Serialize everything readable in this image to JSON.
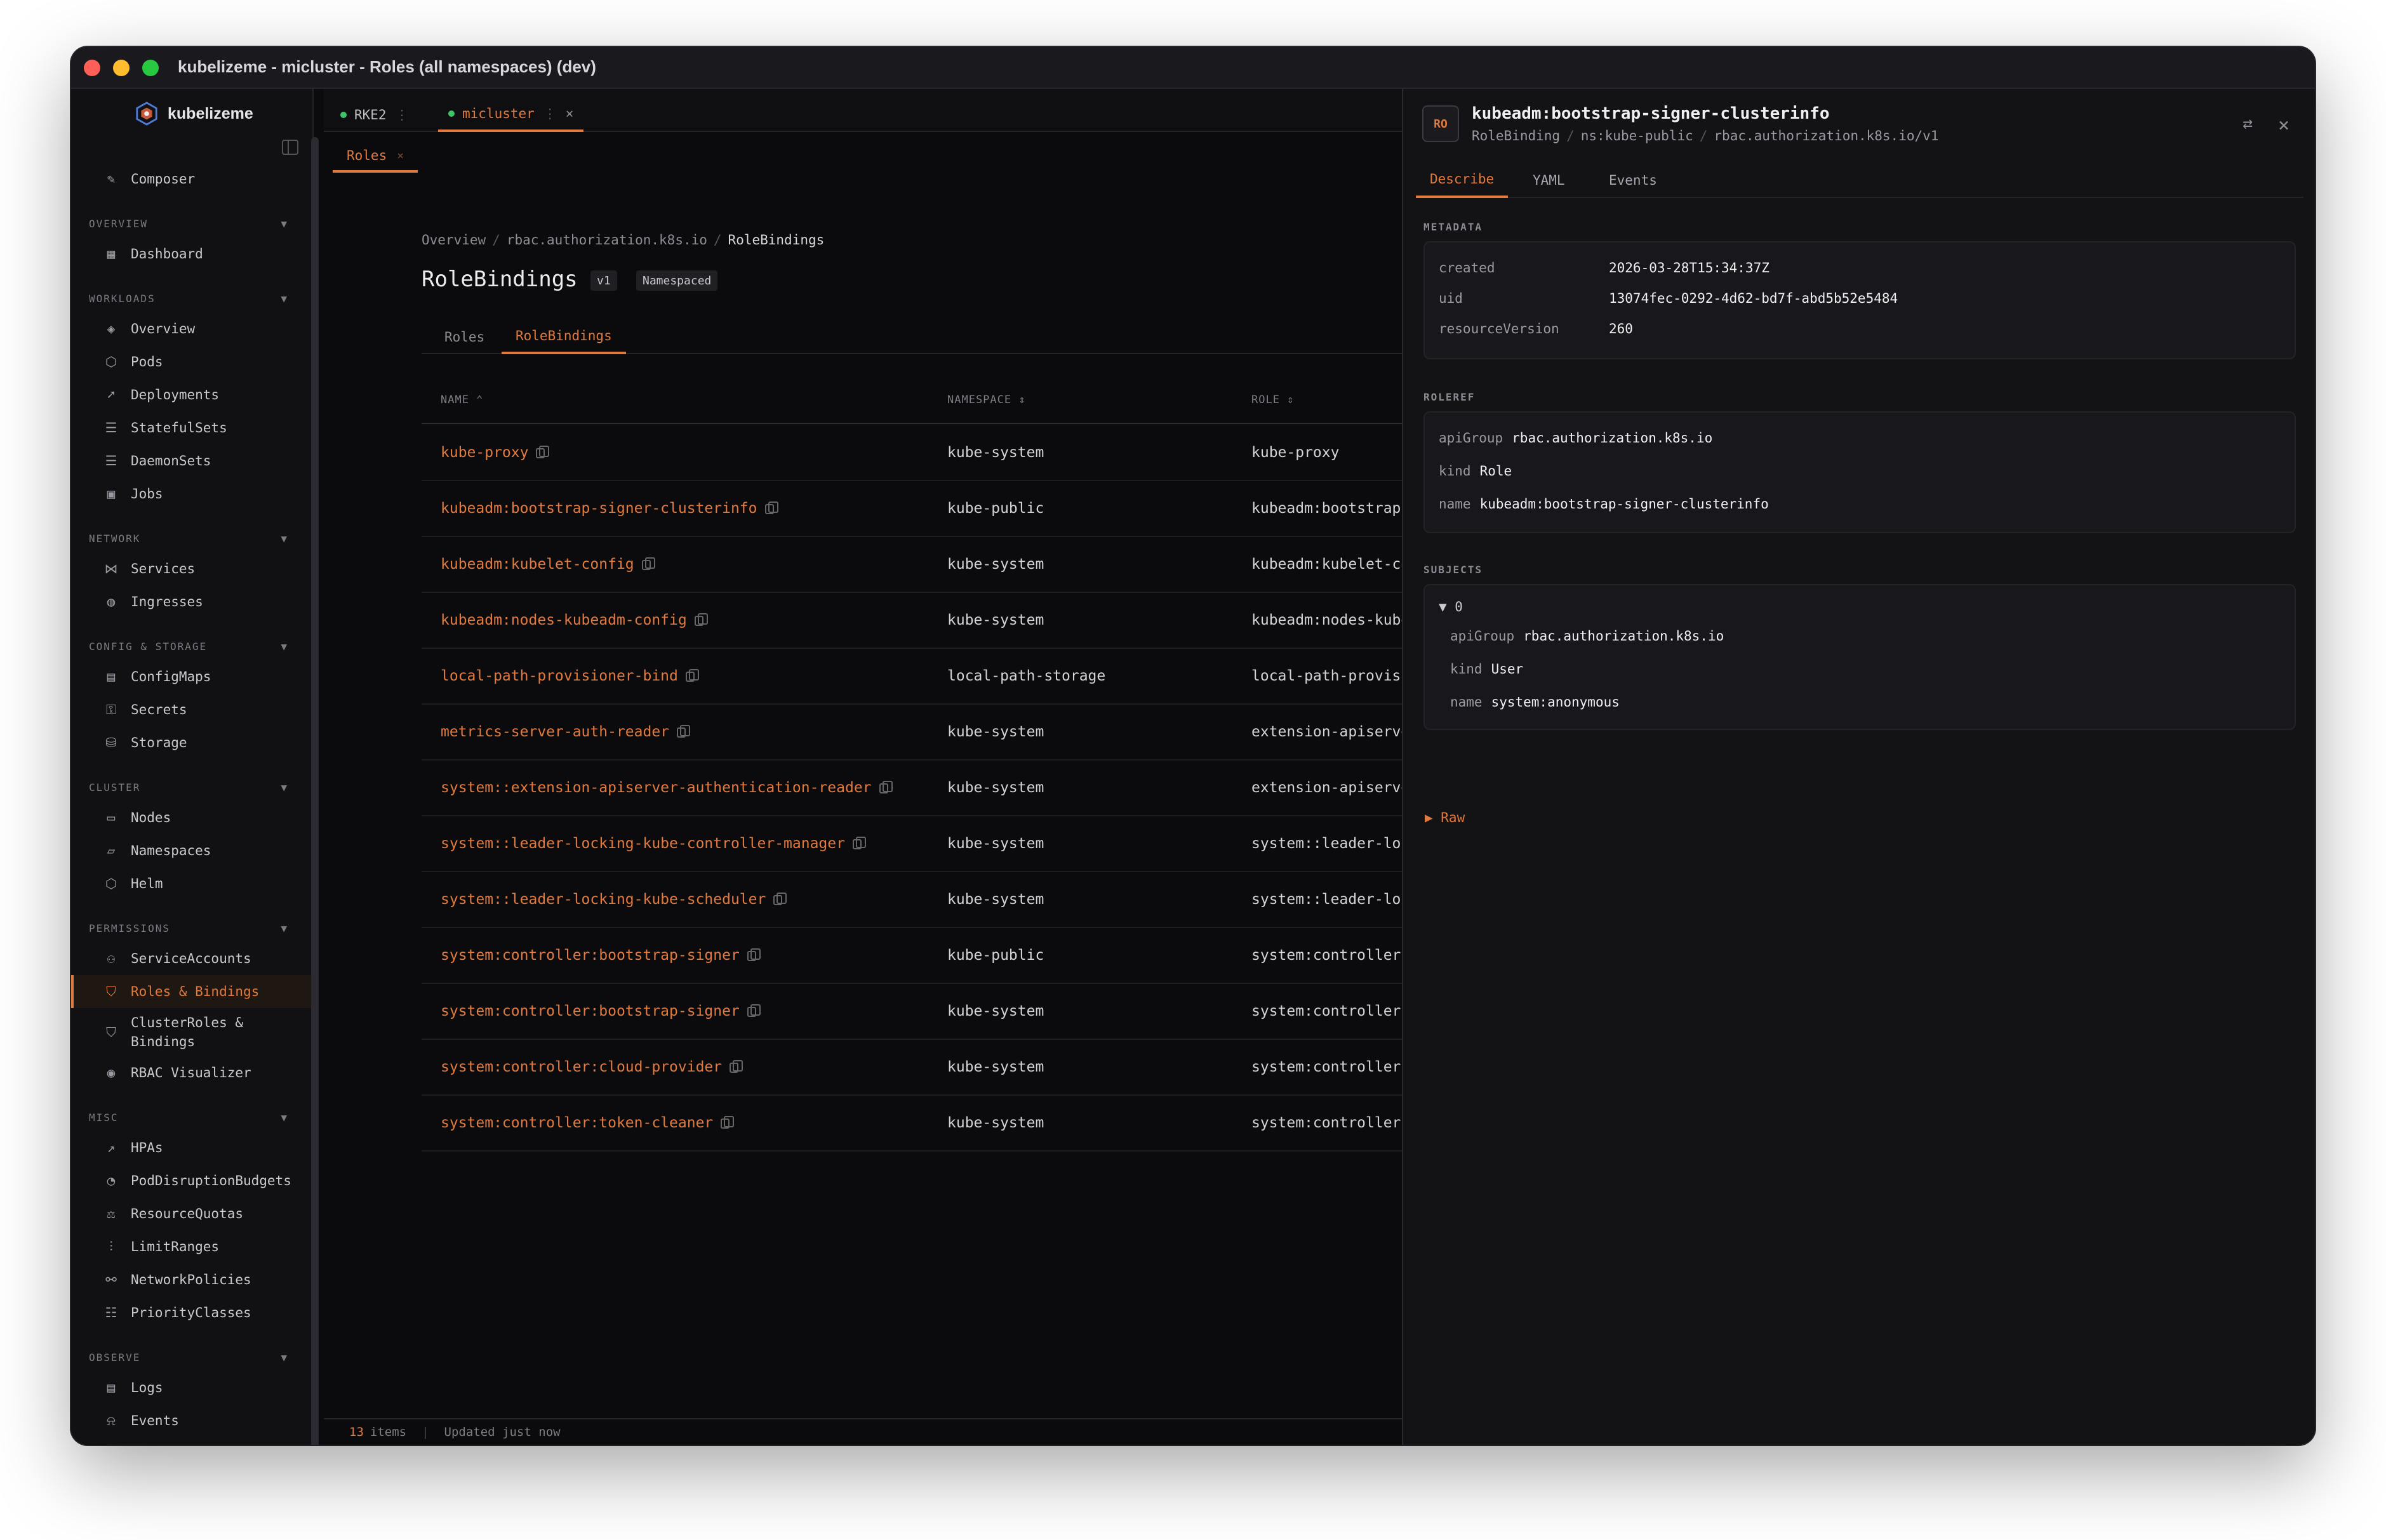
{
  "window": {
    "title": "kubelizeme - micluster - Roles (all namespaces) (dev)"
  },
  "brand": {
    "name": "kubelizeme"
  },
  "sidebar": {
    "composer": "Composer",
    "sections": [
      {
        "label": "OVERVIEW",
        "items": [
          "Dashboard"
        ]
      },
      {
        "label": "WORKLOADS",
        "items": [
          "Overview",
          "Pods",
          "Deployments",
          "StatefulSets",
          "DaemonSets",
          "Jobs"
        ]
      },
      {
        "label": "NETWORK",
        "items": [
          "Services",
          "Ingresses"
        ]
      },
      {
        "label": "CONFIG & STORAGE",
        "items": [
          "ConfigMaps",
          "Secrets",
          "Storage"
        ]
      },
      {
        "label": "CLUSTER",
        "items": [
          "Nodes",
          "Namespaces",
          "Helm"
        ]
      },
      {
        "label": "PERMISSIONS",
        "items": [
          "ServiceAccounts",
          "Roles & Bindings",
          "ClusterRoles & Bindings",
          "RBAC Visualizer"
        ]
      },
      {
        "label": "MISC",
        "items": [
          "HPAs",
          "PodDisruptionBudgets",
          "ResourceQuotas",
          "LimitRanges",
          "NetworkPolicies",
          "PriorityClasses"
        ]
      },
      {
        "label": "OBSERVE",
        "items": [
          "Logs",
          "Events"
        ]
      }
    ],
    "active_item": "Roles & Bindings"
  },
  "cluster_tabs": [
    {
      "label": "RKE2",
      "active": false
    },
    {
      "label": "micluster",
      "active": true
    }
  ],
  "subtab": {
    "label": "Roles"
  },
  "breadcrumb": {
    "a": "Overview",
    "b": "rbac.authorization.k8s.io",
    "c": "RoleBindings"
  },
  "page": {
    "title": "RoleBindings",
    "badge_version": "v1",
    "badge_scope": "Namespaced"
  },
  "inner_tabs": {
    "roles": "Roles",
    "rolebindings": "RoleBindings"
  },
  "table": {
    "headers": {
      "name": "NAME ⌃",
      "namespace": "NAMESPACE ⇕",
      "role": "ROLE ⇕"
    },
    "rows": [
      {
        "name": "kube-proxy",
        "namespace": "kube-system",
        "role": "kube-proxy"
      },
      {
        "name": "kubeadm:bootstrap-signer-clusterinfo",
        "namespace": "kube-public",
        "role": "kubeadm:bootstrap-signer"
      },
      {
        "name": "kubeadm:kubelet-config",
        "namespace": "kube-system",
        "role": "kubeadm:kubelet-config"
      },
      {
        "name": "kubeadm:nodes-kubeadm-config",
        "namespace": "kube-system",
        "role": "kubeadm:nodes-kubeadm-co"
      },
      {
        "name": "local-path-provisioner-bind",
        "namespace": "local-path-storage",
        "role": "local-path-provisioner-r"
      },
      {
        "name": "metrics-server-auth-reader",
        "namespace": "kube-system",
        "role": "extension-apiserver-auth"
      },
      {
        "name": "system::extension-apiserver-authentication-reader",
        "namespace": "kube-system",
        "role": "extension-apiserver-auth"
      },
      {
        "name": "system::leader-locking-kube-controller-manager",
        "namespace": "kube-system",
        "role": "system::leader-locking-k"
      },
      {
        "name": "system::leader-locking-kube-scheduler",
        "namespace": "kube-system",
        "role": "system::leader-locking-k"
      },
      {
        "name": "system:controller:bootstrap-signer",
        "namespace": "kube-public",
        "role": "system:controller:bootst"
      },
      {
        "name": "system:controller:bootstrap-signer",
        "namespace": "kube-system",
        "role": "system:controller:bootst"
      },
      {
        "name": "system:controller:cloud-provider",
        "namespace": "kube-system",
        "role": "system:controller:cloud-"
      },
      {
        "name": "system:controller:token-cleaner",
        "namespace": "kube-system",
        "role": "system:controller:token-"
      }
    ]
  },
  "status": {
    "count": "13",
    "count_label": "items",
    "updated": "Updated just now"
  },
  "detail": {
    "icon_text": "RO",
    "title": "kubeadm:bootstrap-signer-clusterinfo",
    "kind": "RoleBinding",
    "namespace": "ns:kube-public",
    "api": "rbac.authorization.k8s.io/v1",
    "tabs": [
      "Describe",
      "YAML",
      "Events"
    ],
    "metadata_label": "METADATA",
    "metadata": {
      "created_k": "created",
      "created_v": "2026-03-28T15:34:37Z",
      "uid_k": "uid",
      "uid_v": "13074fec-0292-4d62-bd7f-abd5b52e5484",
      "rv_k": "resourceVersion",
      "rv_v": "260"
    },
    "roleref_label": "ROLEREF",
    "roleref": {
      "apiGroup_k": "apiGroup",
      "apiGroup_v": "rbac.authorization.k8s.io",
      "kind_k": "kind",
      "kind_v": "Role",
      "name_k": "name",
      "name_v": "kubeadm:bootstrap-signer-clusterinfo"
    },
    "subjects_label": "SUBJECTS",
    "subjects": {
      "index": "▼ 0",
      "apiGroup_k": "apiGroup",
      "apiGroup_v": "rbac.authorization.k8s.io",
      "kind_k": "kind",
      "kind_v": "User",
      "name_k": "name",
      "name_v": "system:anonymous"
    },
    "raw": "▶ Raw"
  },
  "colors": {
    "accent": "#e07a3f",
    "background": "#0b0b0d",
    "panel": "#131316"
  }
}
